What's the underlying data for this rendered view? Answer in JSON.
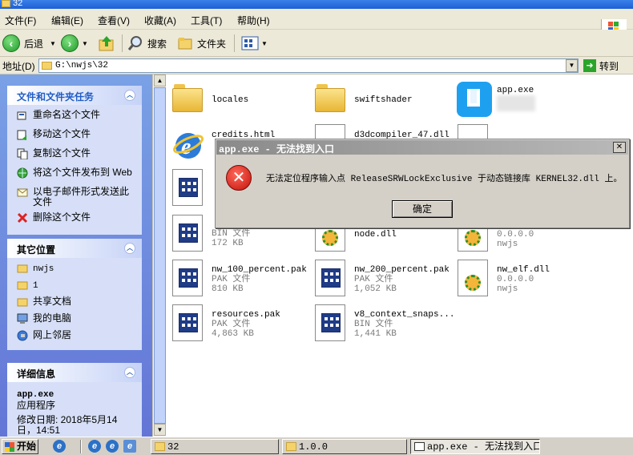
{
  "window": {
    "title": "32"
  },
  "menu": [
    "文件(F)",
    "编辑(E)",
    "查看(V)",
    "收藏(A)",
    "工具(T)",
    "帮助(H)"
  ],
  "toolbar": {
    "back": "后退",
    "search": "搜索",
    "folders": "文件夹"
  },
  "address": {
    "label": "地址(D)",
    "value": "G:\\nwjs\\32",
    "go": "转到"
  },
  "tasks_panel": {
    "title": "文件和文件夹任务",
    "items": [
      "重命名这个文件",
      "移动这个文件",
      "复制这个文件",
      "将这个文件发布到 Web",
      "以电子邮件形式发送此文件",
      "删除这个文件"
    ]
  },
  "places_panel": {
    "title": "其它位置",
    "items": [
      "nwjs",
      "1",
      "共享文档",
      "我的电脑",
      "网上邻居"
    ]
  },
  "details_panel": {
    "title": "详细信息",
    "name": "app.exe",
    "type": "应用程序",
    "modified": "修改日期: 2018年5月14日，14:51"
  },
  "files": [
    {
      "name": "locales",
      "sub1": "",
      "sub2": "",
      "icon": "folder"
    },
    {
      "name": "swiftshader",
      "sub1": "",
      "sub2": "",
      "icon": "folder"
    },
    {
      "name": "app.exe",
      "sub1": "",
      "sub2": "",
      "icon": "app-icon"
    },
    {
      "name": "credits.html",
      "sub1": "",
      "sub2": "",
      "icon": "ie-icon"
    },
    {
      "name": "d3dcompiler_47.dll",
      "sub1": "",
      "sub2": "",
      "icon": "dll-icon"
    },
    {
      "name": "",
      "sub1": "",
      "sub2": "",
      "icon": "dll-icon"
    },
    {
      "name": "BIN 文件",
      "sub1": "172 KB",
      "sub2": "",
      "icon": "bin-icon"
    },
    {
      "name": "node.dll",
      "sub1": "",
      "sub2": "",
      "icon": "dll-icon"
    },
    {
      "name": "0.0.0.0",
      "sub1": "nwjs",
      "sub2": "",
      "icon": "dll-icon"
    },
    {
      "name": "nw_100_percent.pak",
      "sub1": "PAK 文件",
      "sub2": "810 KB",
      "icon": "pak-icon"
    },
    {
      "name": "nw_200_percent.pak",
      "sub1": "PAK 文件",
      "sub2": "1,052 KB",
      "icon": "pak-icon"
    },
    {
      "name": "nw_elf.dll",
      "sub1": "0.0.0.0",
      "sub2": "nwjs",
      "icon": "dll-icon"
    },
    {
      "name": "resources.pak",
      "sub1": "PAK 文件",
      "sub2": "4,863 KB",
      "icon": "pak-icon"
    },
    {
      "name": "v8_context_snaps...",
      "sub1": "BIN 文件",
      "sub2": "1,441 KB",
      "icon": "bin-icon"
    }
  ],
  "dialog": {
    "title": "app.exe - 无法找到入口",
    "message": "无法定位程序输入点 ReleaseSRWLockExclusive 于动态链接库 KERNEL32.dll 上。",
    "ok": "确定"
  },
  "taskbar": {
    "start": "开始",
    "tasks": [
      "32",
      "1.0.0",
      "app.exe - 无法找到入口"
    ]
  }
}
